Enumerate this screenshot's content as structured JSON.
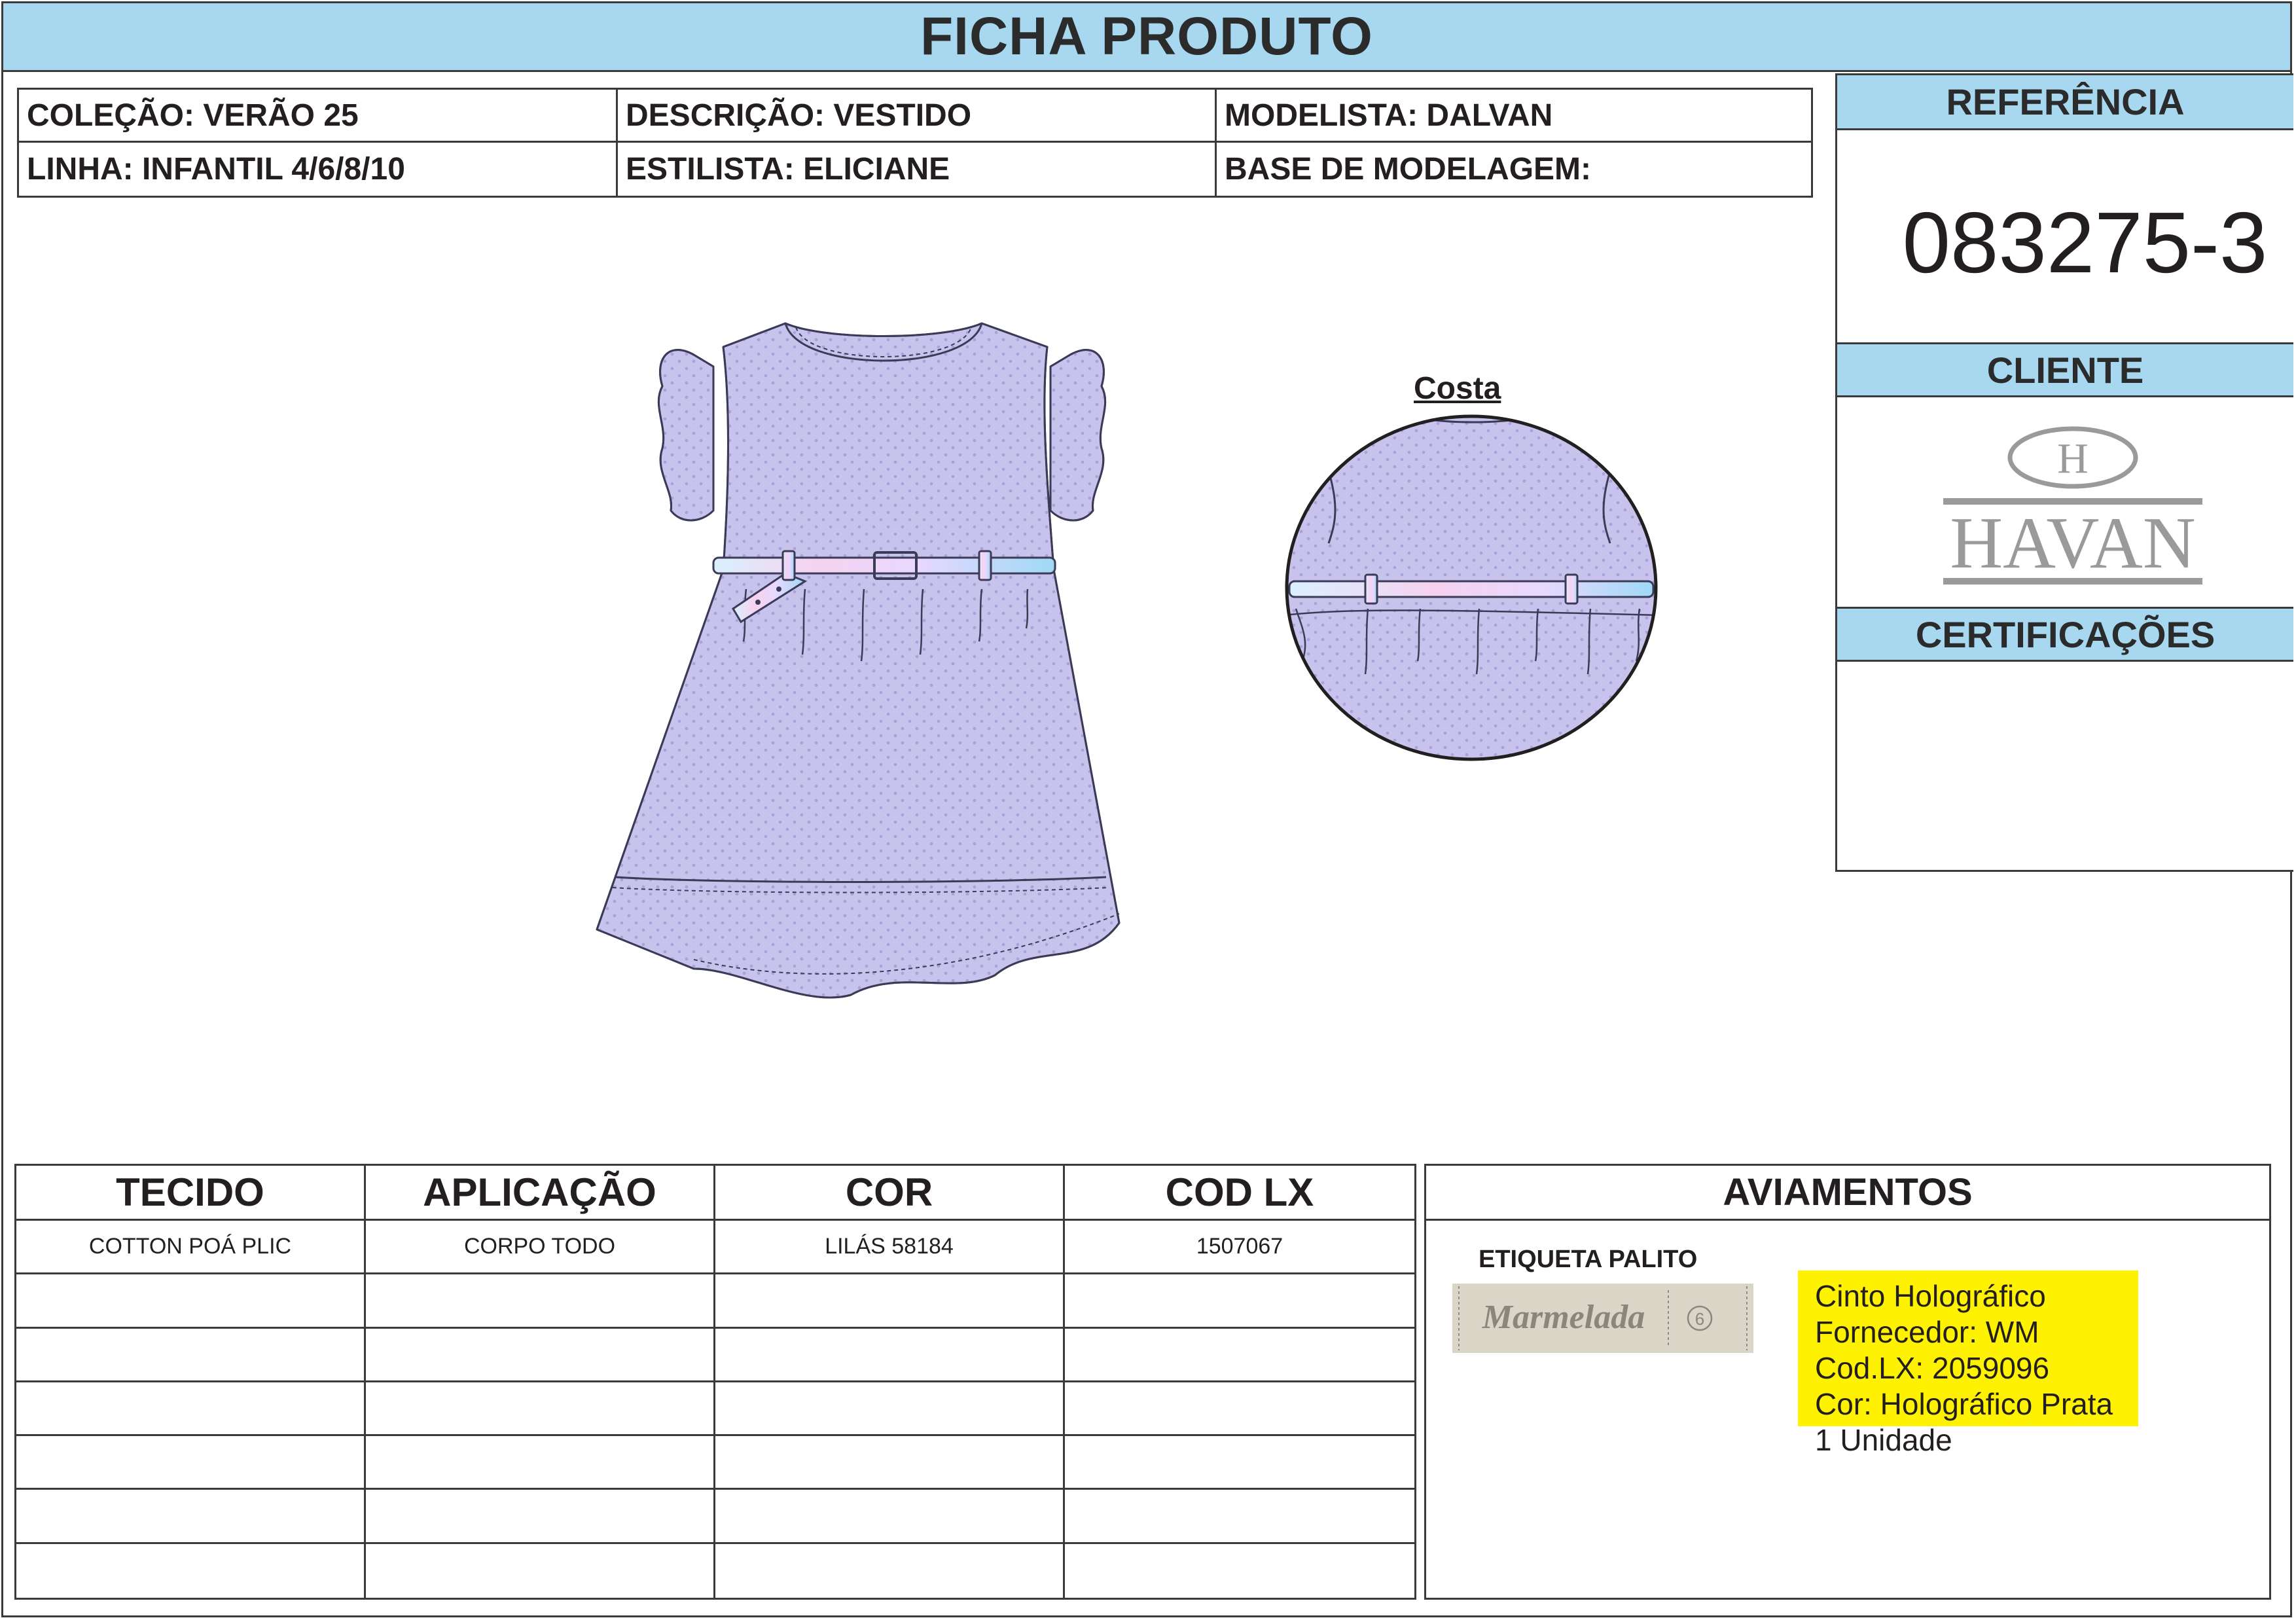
{
  "title": "FICHA PRODUTO",
  "header": {
    "colecao": "COLEÇÃO: VERÃO 25",
    "descricao": "DESCRIÇÃO: VESTIDO",
    "modelista": "MODELISTA: DALVAN",
    "linha": "LINHA: INFANTIL 4/6/8/10",
    "estilista": "ESTILISTA: ELICIANE",
    "base": "BASE DE MODELAGEM:"
  },
  "side": {
    "referencia_label": "REFERÊNCIA",
    "referencia": "083275-3",
    "cliente_label": "CLIENTE",
    "cliente_logo_text": "HAVAN",
    "cliente_logo_letter": "H",
    "certificacoes_label": "CERTIFICAÇÕES"
  },
  "drawing": {
    "costa_label": "Costa",
    "fabric_color": "#c7c3ec",
    "outline_color": "#3b3a57"
  },
  "table": {
    "headers": [
      "TECIDO",
      "APLICAÇÃO",
      "COR",
      "COD LX"
    ],
    "rows": [
      [
        "COTTON POÁ PLIC",
        "CORPO TODO",
        "LILÁS 58184",
        "1507067"
      ],
      [
        "",
        "",
        "",
        ""
      ],
      [
        "",
        "",
        "",
        ""
      ],
      [
        "",
        "",
        "",
        ""
      ],
      [
        "",
        "",
        "",
        ""
      ],
      [
        "",
        "",
        "",
        ""
      ],
      [
        "",
        "",
        "",
        ""
      ]
    ]
  },
  "aviamentos": {
    "title": "AVIAMENTOS",
    "etiqueta_label": "ETIQUETA PALITO",
    "etiqueta_brand": "Marmelada",
    "etiqueta_size": "6",
    "note_lines": [
      "Cinto Holográfico",
      "Fornecedor: WM",
      "Cod.LX: 2059096",
      "Cor: Holográfico Prata",
      "1 Unidade"
    ],
    "note_color": "#fff200"
  }
}
